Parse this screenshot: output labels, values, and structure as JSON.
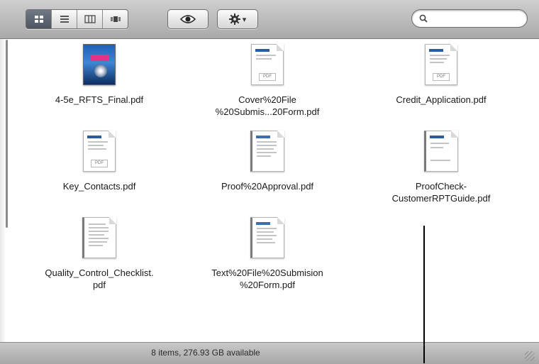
{
  "toolbar": {
    "view_buttons": [
      {
        "name": "icon-view",
        "icon": "icon-view-icon",
        "active": true
      },
      {
        "name": "list-view",
        "icon": "list-view-icon",
        "active": false
      },
      {
        "name": "column-view",
        "icon": "column-view-icon",
        "active": false
      },
      {
        "name": "coverflow-view",
        "icon": "coverflow-view-icon",
        "active": false
      }
    ],
    "quicklook_icon": "eye-icon",
    "action_icon": "gear-icon",
    "action_chevron": "▾",
    "search": {
      "value": "",
      "placeholder": ""
    }
  },
  "files": [
    {
      "name": "4-5e_RFTS_Final.pdf",
      "icon": "cover-pdf-icon"
    },
    {
      "name": "Cover%20File\n%20Submis...20Form.pdf",
      "icon": "pdf-document-icon"
    },
    {
      "name": "Credit_Application.pdf",
      "icon": "pdf-document-icon"
    },
    {
      "name": "Key_Contacts.pdf",
      "icon": "pdf-document-icon"
    },
    {
      "name": "Proof%20Approval.pdf",
      "icon": "spiral-document-icon"
    },
    {
      "name": "ProofCheck-\nCustomerRPTGuide.pdf",
      "icon": "spiral-document-icon"
    },
    {
      "name": "Quality_Control_Checklist.\npdf",
      "icon": "spiral-document-icon"
    },
    {
      "name": "Text%20File%20Submision\n%20Form.pdf",
      "icon": "spiral-document-icon"
    }
  ],
  "status": {
    "text": "8 items, 276.93 GB available"
  },
  "colors": {
    "toolbar_top": "#cfcfcf",
    "toolbar_bottom": "#a9a9a9",
    "doc_header": "#2a5d9e"
  }
}
